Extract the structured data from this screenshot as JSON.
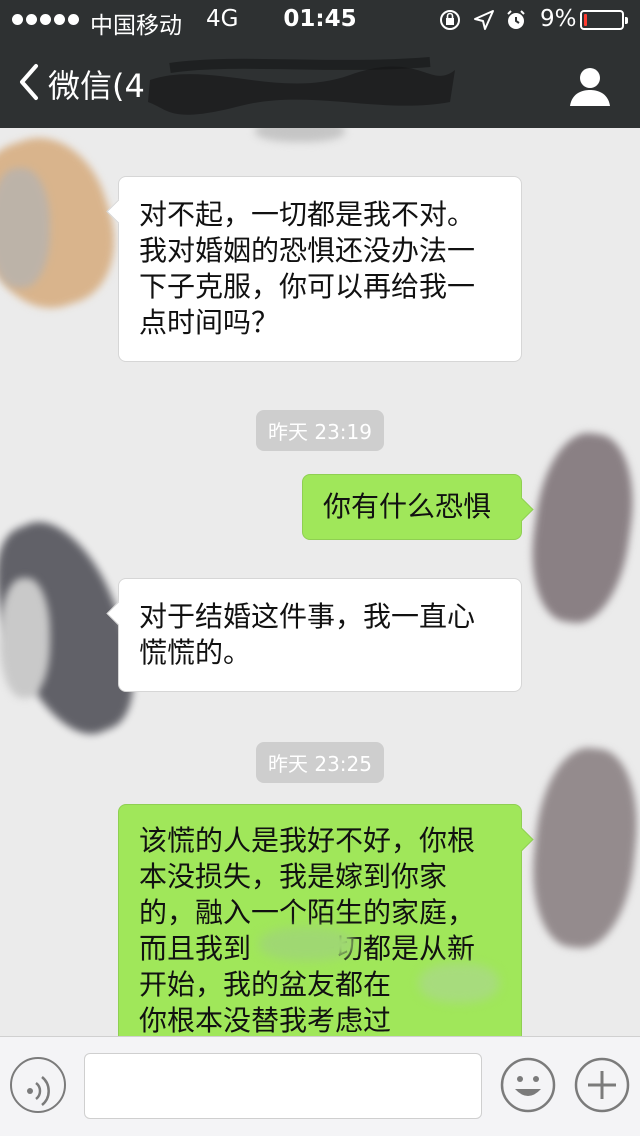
{
  "status_bar": {
    "carrier": "中国移动",
    "network": "4G",
    "time": "01:45",
    "battery_percent": "9%",
    "battery_level": 0.09,
    "icons": [
      "signal-dots-icon",
      "rotation-lock-icon",
      "location-arrow-icon",
      "alarm-icon",
      "battery-icon"
    ]
  },
  "nav": {
    "back_label": "微信(4",
    "right_icon": "person-icon",
    "colors": {
      "bar": "#2e3132",
      "text": "#ffffff"
    }
  },
  "messages": [
    {
      "side": "left",
      "lines": [
        "对不起，一切都是我不对。",
        "我对婚姻的恐惧还没办法一",
        "下子克服，你可以再给我一",
        "点时间吗？"
      ]
    },
    {
      "type": "time",
      "text": "昨天 23:19"
    },
    {
      "side": "right",
      "lines": [
        "你有什么恐惧"
      ]
    },
    {
      "side": "left",
      "lines": [
        "对于结婚这件事，我一直心",
        "慌慌的。"
      ]
    },
    {
      "type": "time",
      "text": "昨天 23:25"
    },
    {
      "side": "right",
      "lines": [
        "该慌的人是我好不好，你根",
        "本没损失，我是嫁到你家",
        "的，融入一个陌生的家庭，",
        "而且我到",
        "一切都是从新",
        "开始，我的盆友都在",
        "你根本没替我考虑过"
      ]
    }
  ],
  "input_bar": {
    "icons": [
      "voice-icon",
      "emoji-icon",
      "plus-icon"
    ]
  },
  "colors": {
    "chat_bg": "#ebebeb",
    "incoming_bubble": "#ffffff",
    "outgoing_bubble": "#a0e75a",
    "time_pill": "#cecece",
    "battery_low": "#ff3b30"
  }
}
